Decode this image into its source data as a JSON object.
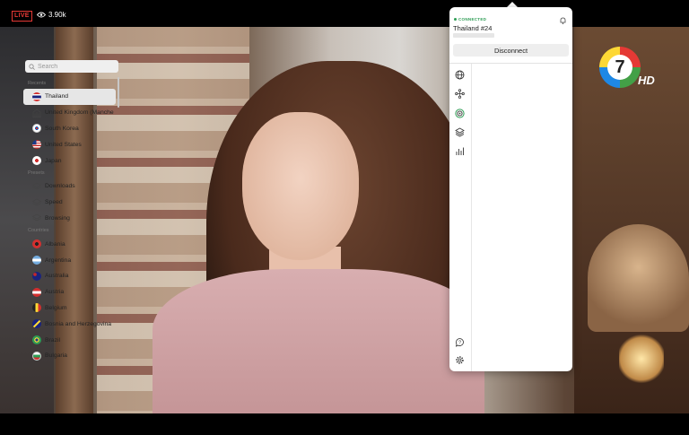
{
  "stream": {
    "live_label": "LIVE",
    "viewers": "3.90k",
    "channel_number": "7",
    "channel_badge": "HD"
  },
  "vpn": {
    "status": "CONNECTED",
    "server": "Thailand #24",
    "disconnect_label": "Disconnect",
    "search_placeholder": "Search",
    "sections": {
      "recents": "Recents",
      "presets": "Presets",
      "countries": "Countries"
    },
    "recents": [
      {
        "label": "Thailand",
        "icon": "thailand-flag",
        "selected": true
      },
      {
        "label": "United Kingdom (Manche",
        "icon": "building-icon"
      },
      {
        "label": "South Korea",
        "icon": "south-korea-flag"
      },
      {
        "label": "United States",
        "icon": "united-states-flag"
      },
      {
        "label": "Japan",
        "icon": "japan-flag"
      }
    ],
    "presets": [
      {
        "label": "Downloads",
        "icon": "layers-icon"
      },
      {
        "label": "Speed",
        "icon": "layers-icon"
      },
      {
        "label": "Browsing",
        "icon": "layers-icon"
      }
    ],
    "countries": [
      {
        "label": "Albania",
        "icon": "albania-flag"
      },
      {
        "label": "Argentina",
        "icon": "argentina-flag"
      },
      {
        "label": "Australia",
        "icon": "australia-flag"
      },
      {
        "label": "Austria",
        "icon": "austria-flag"
      },
      {
        "label": "Belgium",
        "icon": "belgium-flag"
      },
      {
        "label": "Bosnia and Herzegovina",
        "icon": "bosnia-flag"
      },
      {
        "label": "Brazil",
        "icon": "brazil-flag"
      },
      {
        "label": "Bulgaria",
        "icon": "bulgaria-flag"
      }
    ],
    "colors": {
      "connected": "#2e9d55",
      "selected_row": "#e6e6e6"
    }
  }
}
